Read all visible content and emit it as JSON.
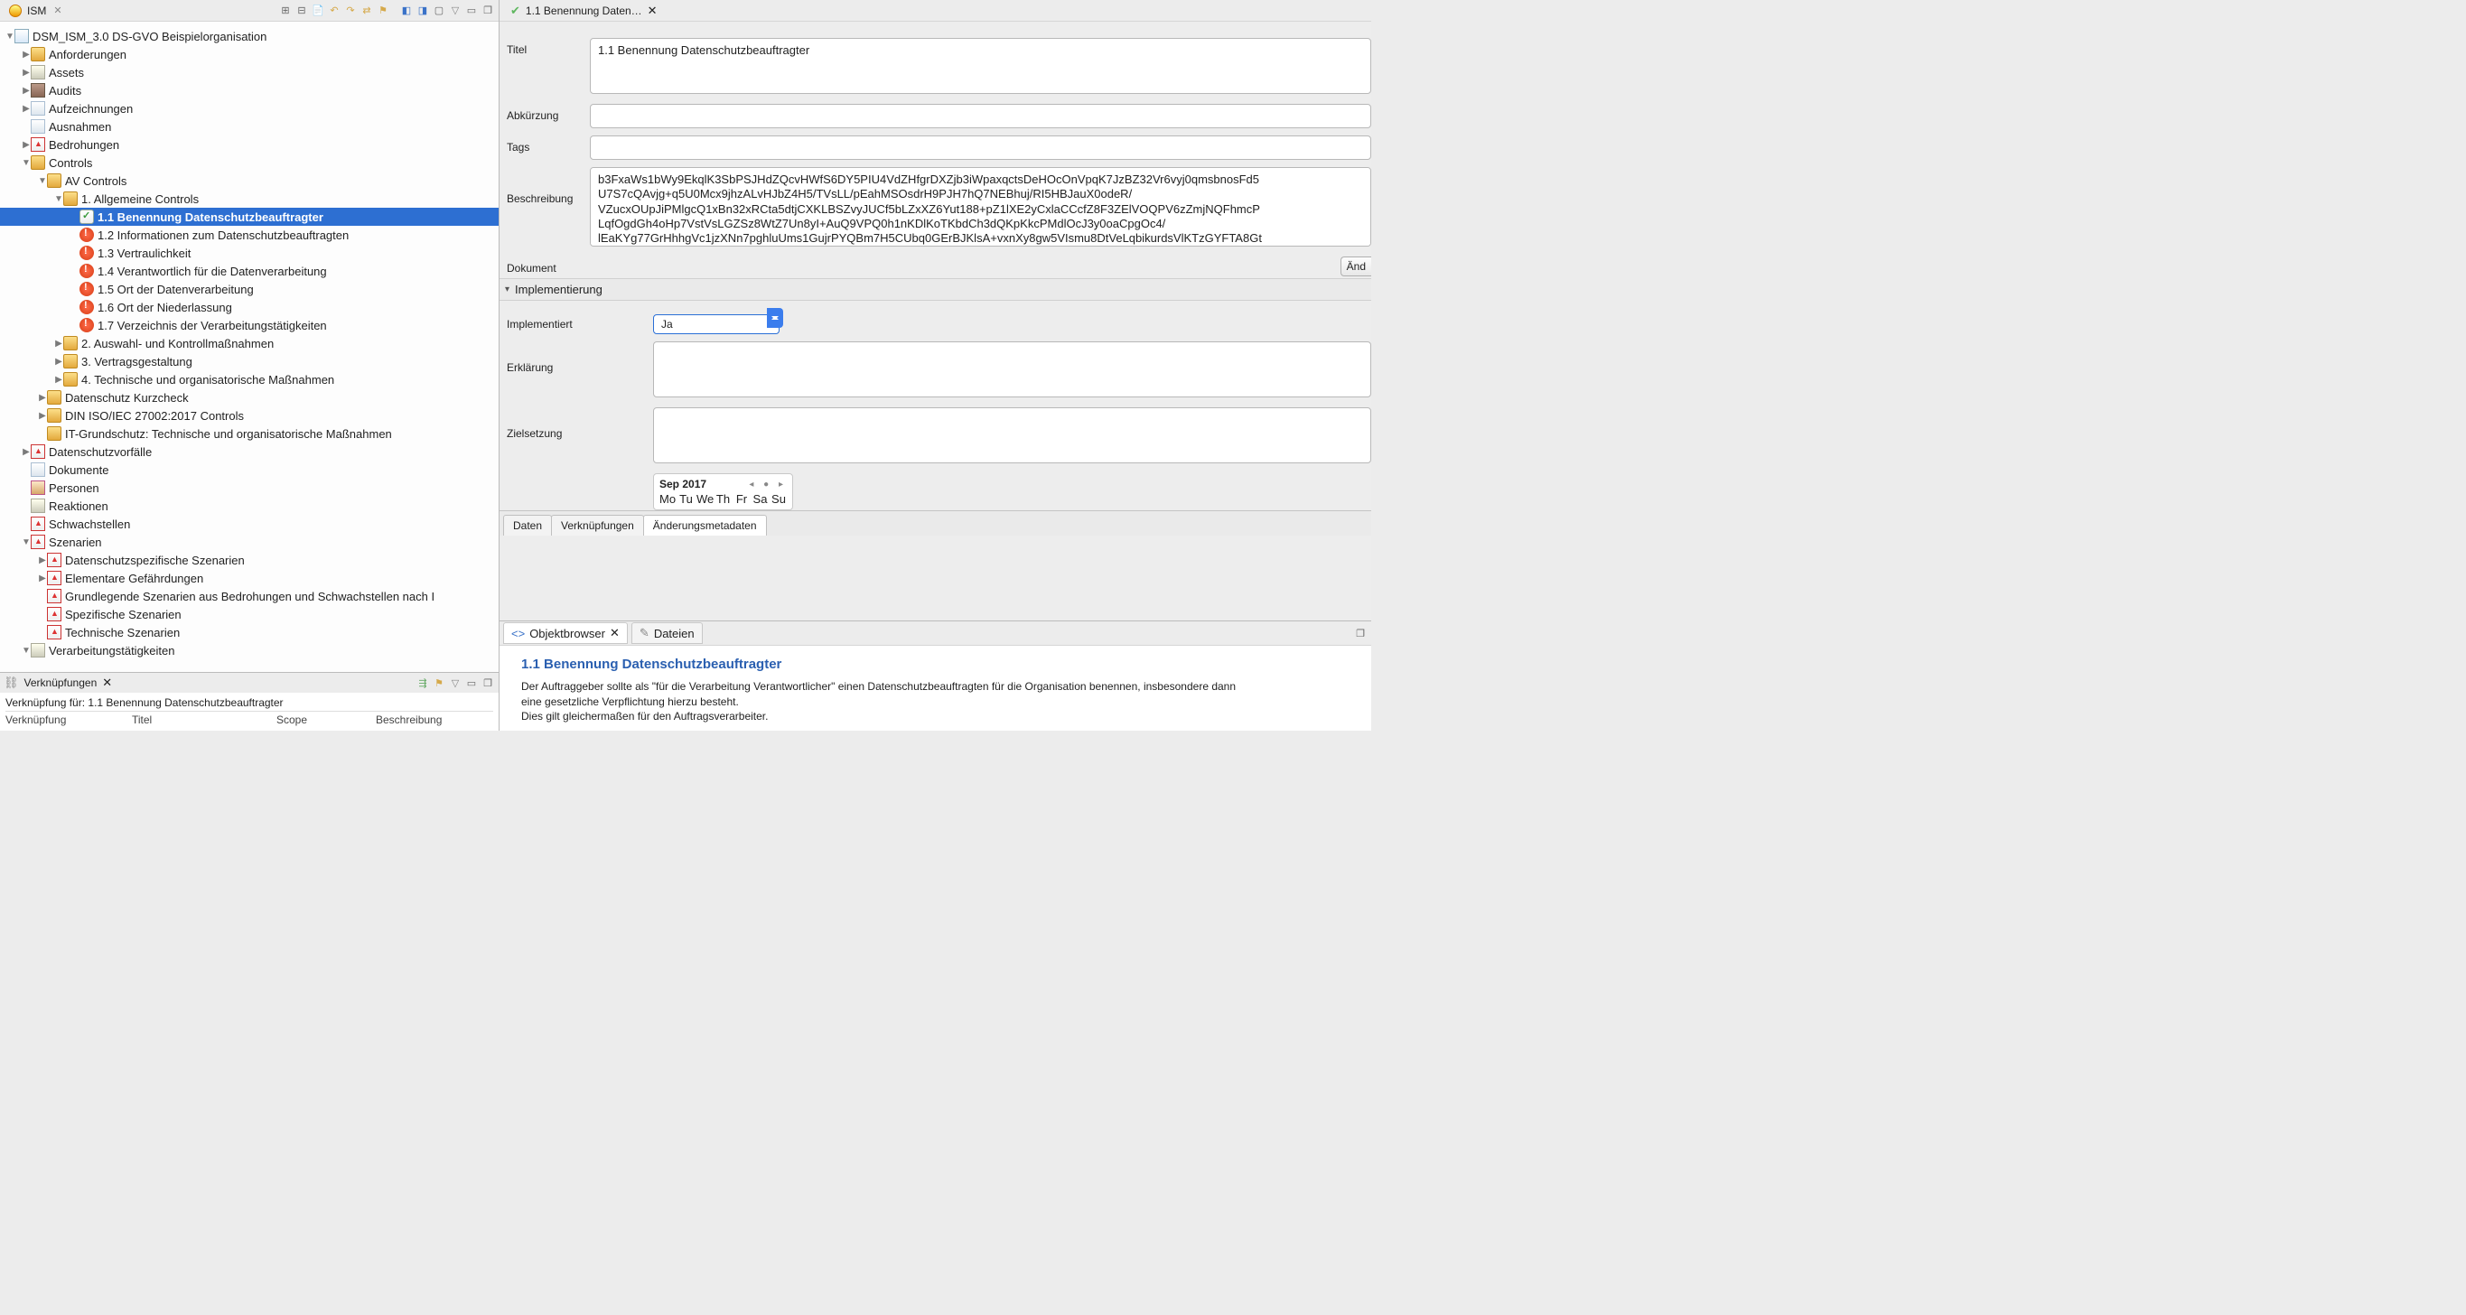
{
  "left_view": {
    "tab_label": "ISM",
    "toolbar_icons": [
      "expand-all",
      "collapse-all",
      "copy",
      "undo",
      "redo",
      "tree-sort",
      "filter",
      "link",
      "export",
      "import",
      "box",
      "minimize",
      "maximize"
    ]
  },
  "tree": [
    {
      "d": 0,
      "exp": "open",
      "icon": "org",
      "label": "DSM_ISM_3.0 DS-GVO Beispielorganisation"
    },
    {
      "d": 1,
      "exp": "closed",
      "icon": "folder",
      "label": "Anforderungen"
    },
    {
      "d": 1,
      "exp": "closed",
      "icon": "cube",
      "label": "Assets"
    },
    {
      "d": 1,
      "exp": "closed",
      "icon": "book",
      "label": "Audits"
    },
    {
      "d": 1,
      "exp": "closed",
      "icon": "doc",
      "label": "Aufzeichnungen"
    },
    {
      "d": 1,
      "exp": "none",
      "icon": "doc",
      "label": "Ausnahmen"
    },
    {
      "d": 1,
      "exp": "closed",
      "icon": "warn",
      "label": "Bedrohungen"
    },
    {
      "d": 1,
      "exp": "open",
      "icon": "folder",
      "label": "Controls"
    },
    {
      "d": 2,
      "exp": "open",
      "icon": "folder",
      "label": "AV Controls"
    },
    {
      "d": 3,
      "exp": "open",
      "icon": "folder",
      "label": "1. Allgemeine Controls"
    },
    {
      "d": 4,
      "exp": "none",
      "icon": "check",
      "label": "1.1 Benennung Datenschutzbeauftragter",
      "sel": true
    },
    {
      "d": 4,
      "exp": "none",
      "icon": "red",
      "label": "1.2 Informationen zum Datenschutzbeauftragten"
    },
    {
      "d": 4,
      "exp": "none",
      "icon": "red",
      "label": "1.3 Vertraulichkeit"
    },
    {
      "d": 4,
      "exp": "none",
      "icon": "red",
      "label": "1.4 Verantwortlich für die Datenverarbeitung"
    },
    {
      "d": 4,
      "exp": "none",
      "icon": "red",
      "label": "1.5 Ort der Datenverarbeitung"
    },
    {
      "d": 4,
      "exp": "none",
      "icon": "red",
      "label": "1.6 Ort der Niederlassung"
    },
    {
      "d": 4,
      "exp": "none",
      "icon": "red",
      "label": "1.7 Verzeichnis der Verarbeitungstätigkeiten"
    },
    {
      "d": 3,
      "exp": "closed",
      "icon": "folder",
      "label": "2. Auswahl- und Kontrollmaßnahmen"
    },
    {
      "d": 3,
      "exp": "closed",
      "icon": "folder",
      "label": "3. Vertragsgestaltung"
    },
    {
      "d": 3,
      "exp": "closed",
      "icon": "folder",
      "label": "4. Technische und organisatorische Maßnahmen"
    },
    {
      "d": 2,
      "exp": "closed",
      "icon": "folder",
      "label": "Datenschutz Kurzcheck"
    },
    {
      "d": 2,
      "exp": "closed",
      "icon": "folder",
      "label": "DIN ISO/IEC 27002:2017 Controls"
    },
    {
      "d": 2,
      "exp": "none",
      "icon": "folder",
      "label": "IT-Grundschutz: Technische und organisatorische Maßnahmen"
    },
    {
      "d": 1,
      "exp": "closed",
      "icon": "warn",
      "label": "Datenschutzvorfälle"
    },
    {
      "d": 1,
      "exp": "none",
      "icon": "doc",
      "label": "Dokumente"
    },
    {
      "d": 1,
      "exp": "none",
      "icon": "people",
      "label": "Personen"
    },
    {
      "d": 1,
      "exp": "none",
      "icon": "cube",
      "label": "Reaktionen"
    },
    {
      "d": 1,
      "exp": "none",
      "icon": "warn",
      "label": "Schwachstellen"
    },
    {
      "d": 1,
      "exp": "open",
      "icon": "warn",
      "label": "Szenarien"
    },
    {
      "d": 2,
      "exp": "closed",
      "icon": "warn",
      "label": "Datenschutzspezifische Szenarien"
    },
    {
      "d": 2,
      "exp": "closed",
      "icon": "warn",
      "label": "Elementare Gefährdungen"
    },
    {
      "d": 2,
      "exp": "none",
      "icon": "warn",
      "label": "Grundlegende Szenarien aus Bedrohungen und Schwachstellen nach I"
    },
    {
      "d": 2,
      "exp": "none",
      "icon": "warn",
      "label": "Spezifische Szenarien"
    },
    {
      "d": 2,
      "exp": "none",
      "icon": "warn",
      "label": "Technische Szenarien"
    },
    {
      "d": 1,
      "exp": "open",
      "icon": "cube",
      "label": "Verarbeitungstätigkeiten"
    }
  ],
  "links_view": {
    "tab_label": "Verknüpfungen",
    "subtitle": "Verknüpfung für: 1.1 Benennung Datenschutzbeauftragter",
    "cols": [
      "Verknüpfung",
      "Titel",
      "Scope",
      "Beschreibung"
    ]
  },
  "editor": {
    "tab_label": "1.1 Benennung Daten…",
    "fields": {
      "titel_label": "Titel",
      "titel_value": "1.1 Benennung Datenschutzbeauftragter",
      "abk_label": "Abkürzung",
      "abk_value": "",
      "tags_label": "Tags",
      "tags_value": "",
      "besch_label": "Beschreibung",
      "besch_value": "b3FxaWs1bWy9EkqlK3SbPSJHdZQcvHWfS6DY5PIU4VdZHfgrDXZjb3iWpaxqctsDeHOcOnVpqK7JzBZ32Vr6vyj0qmsbnosFd5\nU7S7cQAvjg+q5U0Mcx9jhzALvHJbZ4H5/TVsLL/pEahMSOsdrH9PJH7hQ7NEBhuj/RI5HBJauX0odeR/\nVZucxOUpJiPMlgcQ1xBn32xRCta5dtjCXKLBSZvyJUCf5bLZxXZ6Yut188+pZ1lXE2yCxlaCCcfZ8F3ZElVOQPV6zZmjNQFhmcP\nLqfOgdGh4oHp7VstVsLGZSz8WtZ7Un8yI+AuQ9VPQ0h1nKDlKoTKbdCh3dQKpKkcPMdlOcJ3y0oaCpgOc4/\nlEaKYg77GrHhhgVc1jzXNn7pghluUms1GujrPYQBm7H5CUbq0GErBJKlsA+vxnXy8gw5VIsmu8DtVeLqbikurdsVlKTzGYFTA8Gt",
      "dok_label": "Dokument",
      "aend_btn": "Änd"
    },
    "impl_section": {
      "header": "Implementierung",
      "impl_label": "Implementiert",
      "impl_value": "Ja",
      "erkl_label": "Erklärung",
      "erkl_value": "",
      "ziel_label": "Zielsetzung",
      "ziel_value": ""
    },
    "calendar": {
      "month": "Sep 2017",
      "dow": [
        "Mo",
        "Tu",
        "We",
        "Th",
        "Fr",
        "Sa",
        "Su"
      ]
    },
    "bottom_tabs": [
      "Daten",
      "Verknüpfungen",
      "Änderungsmetadaten"
    ]
  },
  "obj_browser": {
    "tabs": [
      "Objektbrowser",
      "Dateien"
    ],
    "title": "1.1 Benennung Datenschutzbeauftragter",
    "body": "Der Auftraggeber sollte als \"für die Verarbeitung Verantwortlicher\" einen Datenschutzbeauftragten für die Organisation benennen, insbesondere dann\neine gesetzliche Verpflichtung hierzu besteht.\nDies gilt gleichermaßen für den Auftragsverarbeiter."
  }
}
